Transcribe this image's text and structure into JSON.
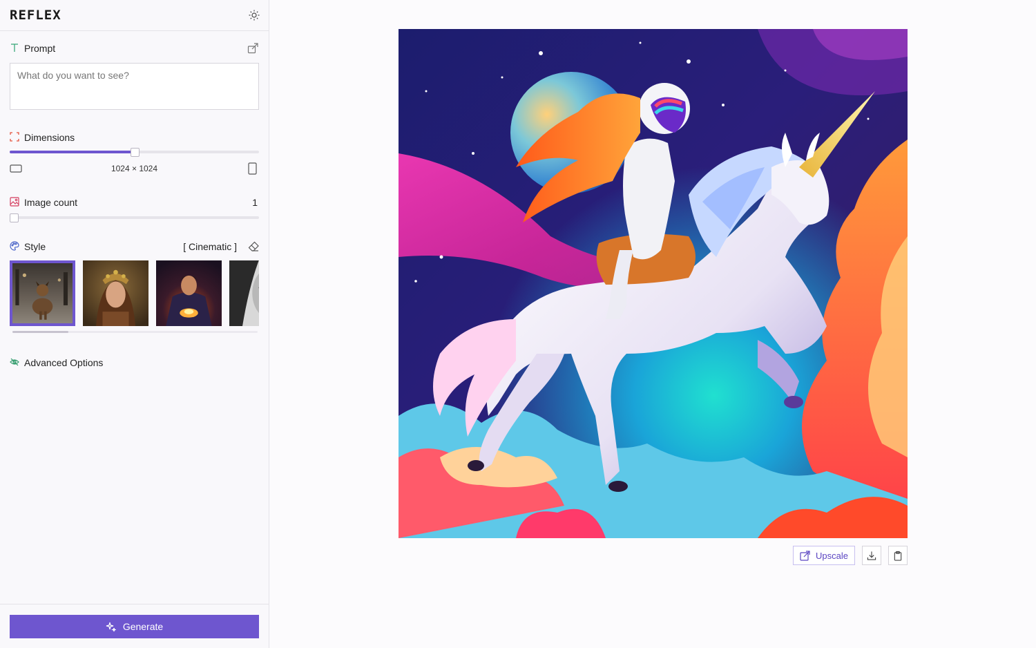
{
  "app": {
    "logo": "REFLEX"
  },
  "prompt": {
    "label": "Prompt",
    "placeholder": "What do you want to see?",
    "value": ""
  },
  "dimensions": {
    "label": "Dimensions",
    "value_text": "1024 × 1024",
    "slider_fraction": 0.5
  },
  "image_count": {
    "label": "Image count",
    "value": "1",
    "slider_fraction": 0.0
  },
  "style": {
    "label": "Style",
    "selected_text": "[ Cinematic ]",
    "thumbnails": [
      "dog-street-thumbnail",
      "woman-crown-thumbnail",
      "sorcerer-fire-thumbnail",
      "bw-portrait-thumbnail"
    ],
    "selected_index": 0
  },
  "advanced": {
    "label": "Advanced Options"
  },
  "generate": {
    "label": "Generate"
  },
  "output": {
    "upscale_label": "Upscale",
    "image": "astronaut-riding-unicorn-space"
  },
  "colors": {
    "accent": "#6e56cf",
    "border": "#e4e2e8",
    "background": "#fcfbfd"
  }
}
